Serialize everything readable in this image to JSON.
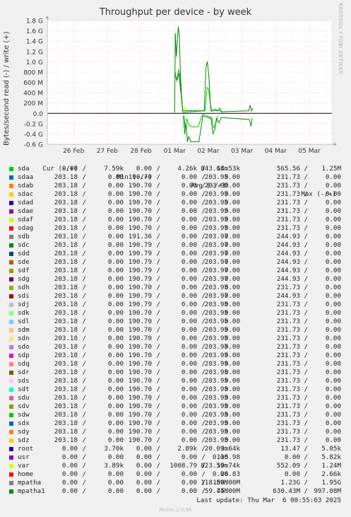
{
  "chart_data": {
    "type": "line",
    "title": "Throughput per device - by week",
    "ylabel": "Bytes/second read (-) / write (+)",
    "ylim": [
      -0.6,
      1.8
    ],
    "yunit": "G",
    "yticks": [
      "1.8 G",
      "1.6 G",
      "1.4 G",
      "1.2 G",
      "1.0 G",
      "800 M",
      "600 M",
      "400 M",
      "200 M",
      "0.0",
      "-0.2 G",
      "-0.4 G",
      "-0.6 G"
    ],
    "xticks": [
      "26 Feb",
      "27 Feb",
      "28 Feb",
      "01 Mar",
      "02 Mar",
      "03 Mar",
      "04 Mar",
      "05 Mar"
    ],
    "grid": true,
    "series": [
      {
        "name": "sda",
        "color": "#00cc00",
        "write_points_G": [
          [
            3.02,
            0.8
          ],
          [
            3.06,
            0.62
          ],
          [
            3.09,
            0.75
          ],
          [
            3.12,
            0.85
          ],
          [
            3.16,
            0.72
          ],
          [
            3.2,
            0.3
          ],
          [
            3.24,
            0.02
          ],
          [
            3.9,
            0.05
          ],
          [
            3.96,
            0.5
          ],
          [
            4.0,
            0.48
          ],
          [
            4.04,
            0.3
          ],
          [
            4.08,
            0.05
          ],
          [
            4.36,
            0.05
          ],
          [
            4.4,
            0.02
          ]
        ],
        "read_points_G": [
          [
            3.28,
            -0.05
          ],
          [
            3.32,
            -0.3
          ],
          [
            3.36,
            -0.1
          ],
          [
            3.42,
            -0.22
          ],
          [
            3.5,
            -0.26
          ],
          [
            3.6,
            -0.26
          ],
          [
            3.7,
            -0.26
          ],
          [
            3.78,
            -0.1
          ],
          [
            3.84,
            -0.02
          ],
          [
            4.1,
            -0.08
          ],
          [
            4.16,
            -0.28
          ],
          [
            4.22,
            -0.2
          ],
          [
            4.28,
            -0.05
          ]
        ]
      },
      {
        "name": "var",
        "color": "#ccff00",
        "write_points_G": [
          [
            3.24,
            0.02
          ],
          [
            3.3,
            0.12
          ],
          [
            3.36,
            0.06
          ]
        ],
        "read_points_G": []
      },
      {
        "name": "mpatha1",
        "color": "#008f00",
        "write_points_G": [
          [
            3.0,
            0.02
          ],
          [
            3.02,
            1.55
          ],
          [
            3.05,
            1.1
          ],
          [
            3.08,
            1.4
          ],
          [
            3.11,
            1.68
          ],
          [
            3.14,
            1.5
          ],
          [
            3.17,
            0.8
          ],
          [
            3.2,
            0.4
          ],
          [
            3.24,
            0.05
          ],
          [
            3.88,
            0.05
          ],
          [
            3.93,
            0.9
          ],
          [
            3.97,
            1.0
          ],
          [
            4.02,
            0.7
          ],
          [
            4.06,
            0.2
          ],
          [
            4.1,
            0.04
          ],
          [
            4.2,
            0.08
          ],
          [
            4.28,
            0.05
          ],
          [
            4.34,
            0.1
          ],
          [
            4.4,
            0.03
          ],
          [
            5.2,
            0.05
          ],
          [
            5.24,
            0.15
          ],
          [
            5.28,
            0.05
          ],
          [
            5.32,
            0.1
          ]
        ],
        "read_points_G": [
          [
            3.26,
            -0.05
          ],
          [
            3.3,
            -0.4
          ],
          [
            3.34,
            -0.2
          ],
          [
            3.38,
            -0.55
          ],
          [
            3.42,
            -0.45
          ],
          [
            3.48,
            -0.55
          ],
          [
            3.6,
            -0.55
          ],
          [
            3.72,
            -0.55
          ],
          [
            3.78,
            -0.3
          ],
          [
            3.84,
            -0.05
          ],
          [
            4.08,
            -0.1
          ],
          [
            4.14,
            -0.4
          ],
          [
            4.2,
            -0.3
          ],
          [
            4.24,
            -0.1
          ],
          [
            4.32,
            -0.18
          ],
          [
            4.38,
            -0.08
          ],
          [
            5.22,
            -0.12
          ],
          [
            5.27,
            -0.25
          ],
          [
            5.3,
            -0.1
          ]
        ]
      },
      {
        "name": "sdb",
        "color": "#3c6e28",
        "write_points_G": [
          [
            3.02,
            0.72
          ],
          [
            3.08,
            0.66
          ],
          [
            3.13,
            0.78
          ],
          [
            3.18,
            0.4
          ]
        ],
        "read_points_G": []
      }
    ]
  },
  "title": "Throughput per device - by week",
  "ylabel_text": "Bytes/second read (-) / write (+)",
  "watermark": "RRDTOOL / TOBI OETIKER",
  "legend": {
    "headers": {
      "cur": "Cur (-/+)",
      "min": "Min (-/+)",
      "avg": "Avg (-/+)",
      "max": "Max (-/+)"
    },
    "rows": [
      {
        "name": "sda",
        "color": "#00cc00",
        "cur_r": "0.00",
        "cur_w": "7.59k",
        "min_r": "0.00",
        "min_w": "4.26k",
        "avg_r": "843.68m",
        "avg_w": "14.53k",
        "max_r": "565.56",
        "max_w": "1.25M"
      },
      {
        "name": "sdaa",
        "color": "#0066b3",
        "cur_r": "203.18",
        "cur_w": "0.00",
        "min_r": "190.70",
        "min_w": "0.00",
        "avg_r": "203.95",
        "avg_w": "0.00",
        "max_r": "231.73",
        "max_w": "0.00"
      },
      {
        "name": "sdab",
        "color": "#ff8000",
        "cur_r": "203.18",
        "cur_w": "0.00",
        "min_r": "190.70",
        "min_w": "0.00",
        "avg_r": "203.95",
        "avg_w": "0.00",
        "max_r": "231.73",
        "max_w": "0.00"
      },
      {
        "name": "sdac",
        "color": "#ffcc00",
        "cur_r": "203.18",
        "cur_w": "0.00",
        "min_r": "190.70",
        "min_w": "0.00",
        "avg_r": "203.95",
        "avg_w": "0.00",
        "max_r": "231.73",
        "max_w": "0.00"
      },
      {
        "name": "sdad",
        "color": "#330099",
        "cur_r": "203.18",
        "cur_w": "0.00",
        "min_r": "190.70",
        "min_w": "0.00",
        "avg_r": "203.95",
        "avg_w": "0.00",
        "max_r": "231.73",
        "max_w": "0.00"
      },
      {
        "name": "sdae",
        "color": "#990099",
        "cur_r": "203.18",
        "cur_w": "0.00",
        "min_r": "190.70",
        "min_w": "0.00",
        "avg_r": "203.95",
        "avg_w": "0.00",
        "max_r": "231.73",
        "max_w": "0.00"
      },
      {
        "name": "sdaf",
        "color": "#ccff00",
        "cur_r": "203.18",
        "cur_w": "0.00",
        "min_r": "190.70",
        "min_w": "0.00",
        "avg_r": "203.95",
        "avg_w": "0.00",
        "max_r": "231.73",
        "max_w": "0.00"
      },
      {
        "name": "sdag",
        "color": "#ff0000",
        "cur_r": "203.18",
        "cur_w": "0.00",
        "min_r": "190.70",
        "min_w": "0.00",
        "avg_r": "203.95",
        "avg_w": "0.00",
        "max_r": "231.73",
        "max_w": "0.00"
      },
      {
        "name": "sdb",
        "color": "#808080",
        "cur_r": "203.18",
        "cur_w": "0.00",
        "min_r": "191.36",
        "min_w": "0.00",
        "avg_r": "203.97",
        "avg_w": "0.00",
        "max_r": "244.93",
        "max_w": "0.00"
      },
      {
        "name": "sdc",
        "color": "#008f00",
        "cur_r": "203.18",
        "cur_w": "0.00",
        "min_r": "190.79",
        "min_w": "0.00",
        "avg_r": "203.97",
        "avg_w": "0.00",
        "max_r": "244.93",
        "max_w": "0.00"
      },
      {
        "name": "sdd",
        "color": "#00487d",
        "cur_r": "203.18",
        "cur_w": "0.00",
        "min_r": "190.79",
        "min_w": "0.00",
        "avg_r": "203.97",
        "avg_w": "0.00",
        "max_r": "244.93",
        "max_w": "0.00"
      },
      {
        "name": "sde",
        "color": "#b35a00",
        "cur_r": "203.18",
        "cur_w": "0.00",
        "min_r": "190.79",
        "min_w": "0.00",
        "avg_r": "203.97",
        "avg_w": "0.00",
        "max_r": "244.93",
        "max_w": "0.00"
      },
      {
        "name": "sdf",
        "color": "#b38f00",
        "cur_r": "203.18",
        "cur_w": "0.00",
        "min_r": "190.79",
        "min_w": "0.00",
        "avg_r": "203.97",
        "avg_w": "0.00",
        "max_r": "244.93",
        "max_w": "0.00"
      },
      {
        "name": "sdg",
        "color": "#6b006b",
        "cur_r": "203.18",
        "cur_w": "0.00",
        "min_r": "190.79",
        "min_w": "0.00",
        "avg_r": "203.97",
        "avg_w": "0.00",
        "max_r": "244.93",
        "max_w": "0.00"
      },
      {
        "name": "sdh",
        "color": "#8fb300",
        "cur_r": "203.18",
        "cur_w": "0.00",
        "min_r": "190.70",
        "min_w": "0.00",
        "avg_r": "203.95",
        "avg_w": "0.00",
        "max_r": "231.73",
        "max_w": "0.00"
      },
      {
        "name": "sdi",
        "color": "#b30000",
        "cur_r": "203.18",
        "cur_w": "0.00",
        "min_r": "190.79",
        "min_w": "0.00",
        "avg_r": "203.97",
        "avg_w": "0.00",
        "max_r": "244.93",
        "max_w": "0.00"
      },
      {
        "name": "sdj",
        "color": "#bebebe",
        "cur_r": "203.18",
        "cur_w": "0.00",
        "min_r": "190.79",
        "min_w": "0.00",
        "avg_r": "203.95",
        "avg_w": "0.00",
        "max_r": "231.73",
        "max_w": "0.00"
      },
      {
        "name": "sdk",
        "color": "#80ff80",
        "cur_r": "203.18",
        "cur_w": "0.00",
        "min_r": "190.70",
        "min_w": "0.00",
        "avg_r": "203.95",
        "avg_w": "0.00",
        "max_r": "231.73",
        "max_w": "0.00"
      },
      {
        "name": "sdl",
        "color": "#80c9ff",
        "cur_r": "203.18",
        "cur_w": "0.00",
        "min_r": "190.70",
        "min_w": "0.00",
        "avg_r": "203.95",
        "avg_w": "0.00",
        "max_r": "231.73",
        "max_w": "0.00"
      },
      {
        "name": "sdm",
        "color": "#ffc080",
        "cur_r": "203.18",
        "cur_w": "0.00",
        "min_r": "190.70",
        "min_w": "0.00",
        "avg_r": "203.95",
        "avg_w": "0.00",
        "max_r": "231.73",
        "max_w": "0.00"
      },
      {
        "name": "sdn",
        "color": "#ffe680",
        "cur_r": "203.18",
        "cur_w": "0.00",
        "min_r": "190.70",
        "min_w": "0.00",
        "avg_r": "203.95",
        "avg_w": "0.00",
        "max_r": "231.73",
        "max_w": "0.00"
      },
      {
        "name": "sdo",
        "color": "#aa80ff",
        "cur_r": "203.18",
        "cur_w": "0.00",
        "min_r": "190.70",
        "min_w": "0.00",
        "avg_r": "203.95",
        "avg_w": "0.00",
        "max_r": "231.73",
        "max_w": "0.00"
      },
      {
        "name": "sdp",
        "color": "#ee00cc",
        "cur_r": "203.18",
        "cur_w": "0.00",
        "min_r": "190.70",
        "min_w": "0.00",
        "avg_r": "203.95",
        "avg_w": "0.00",
        "max_r": "231.73",
        "max_w": "0.00"
      },
      {
        "name": "sdq",
        "color": "#ff8080",
        "cur_r": "203.18",
        "cur_w": "0.00",
        "min_r": "190.70",
        "min_w": "0.00",
        "avg_r": "203.95",
        "avg_w": "0.00",
        "max_r": "231.73",
        "max_w": "0.00"
      },
      {
        "name": "sdr",
        "color": "#666600",
        "cur_r": "203.18",
        "cur_w": "0.00",
        "min_r": "190.70",
        "min_w": "0.00",
        "avg_r": "203.95",
        "avg_w": "0.00",
        "max_r": "231.73",
        "max_w": "0.00"
      },
      {
        "name": "sds",
        "color": "#ffbfff",
        "cur_r": "203.18",
        "cur_w": "0.00",
        "min_r": "190.70",
        "min_w": "0.00",
        "avg_r": "203.95",
        "avg_w": "0.00",
        "max_r": "231.73",
        "max_w": "0.00"
      },
      {
        "name": "sdt",
        "color": "#00ffcc",
        "cur_r": "203.18",
        "cur_w": "0.00",
        "min_r": "190.70",
        "min_w": "0.00",
        "avg_r": "203.95",
        "avg_w": "0.00",
        "max_r": "231.73",
        "max_w": "0.00"
      },
      {
        "name": "sdu",
        "color": "#cc6699",
        "cur_r": "203.18",
        "cur_w": "0.00",
        "min_r": "190.70",
        "min_w": "0.00",
        "avg_r": "203.95",
        "avg_w": "0.00",
        "max_r": "231.73",
        "max_w": "0.00"
      },
      {
        "name": "sdv",
        "color": "#999900",
        "cur_r": "203.18",
        "cur_w": "0.00",
        "min_r": "190.70",
        "min_w": "0.00",
        "avg_r": "203.95",
        "avg_w": "0.00",
        "max_r": "231.73",
        "max_w": "0.00"
      },
      {
        "name": "sdw",
        "color": "#00cc00",
        "cur_r": "203.18",
        "cur_w": "0.00",
        "min_r": "190.70",
        "min_w": "0.00",
        "avg_r": "203.95",
        "avg_w": "0.00",
        "max_r": "231.73",
        "max_w": "0.00"
      },
      {
        "name": "sdx",
        "color": "#0066b3",
        "cur_r": "203.18",
        "cur_w": "0.00",
        "min_r": "190.70",
        "min_w": "0.00",
        "avg_r": "203.95",
        "avg_w": "0.00",
        "max_r": "231.73",
        "max_w": "0.00"
      },
      {
        "name": "sdy",
        "color": "#ff8000",
        "cur_r": "203.18",
        "cur_w": "0.00",
        "min_r": "190.70",
        "min_w": "0.00",
        "avg_r": "203.95",
        "avg_w": "0.00",
        "max_r": "231.73",
        "max_w": "0.00"
      },
      {
        "name": "sdz",
        "color": "#ffcc00",
        "cur_r": "203.18",
        "cur_w": "0.00",
        "min_r": "190.70",
        "min_w": "0.00",
        "avg_r": "203.95",
        "avg_w": "0.00",
        "max_r": "231.73",
        "max_w": "0.00"
      },
      {
        "name": "root",
        "color": "#330099",
        "cur_r": "0.00",
        "cur_w": "3.70k",
        "min_r": "0.00",
        "min_w": "2.89k",
        "avg_r": "20.09m",
        "avg_w": "3.64k",
        "max_r": "13.47",
        "max_w": "5.05k"
      },
      {
        "name": "usr",
        "color": "#990099",
        "cur_r": "0.00",
        "cur_w": "0.00",
        "min_r": "0.00",
        "min_w": "0.00",
        "avg_r": "0.00",
        "avg_w": "115.98",
        "max_r": "0.00",
        "max_w": "5.82k"
      },
      {
        "name": "var",
        "color": "#ccff00",
        "cur_r": "0.00",
        "cur_w": "3.89k",
        "min_r": "0.00",
        "min_w": "1008.79",
        "avg_r": "823.59m",
        "avg_w": "10.74k",
        "max_r": "552.09",
        "max_w": "1.24M"
      },
      {
        "name": "home",
        "color": "#ff0000",
        "cur_r": "0.00",
        "cur_w": "0.00",
        "min_r": "0.00",
        "min_w": "0.00",
        "avg_r": "0.00",
        "avg_w": "26.83",
        "max_r": "0.00",
        "max_w": "2.66k"
      },
      {
        "name": "mpatha",
        "color": "#808080",
        "cur_r": "0.00",
        "cur_w": "0.00",
        "min_r": "0.00",
        "min_w": "0.00",
        "avg_r": "118.89M",
        "avg_w": "150.00M",
        "max_r": "1.23G",
        "max_w": "1.95G"
      },
      {
        "name": "mpatha1",
        "color": "#008f00",
        "cur_r": "0.00",
        "cur_w": "0.00",
        "min_r": "0.00",
        "min_w": "0.00",
        "avg_r": "59.44M",
        "avg_w": "75.00M",
        "max_r": "630.43M",
        "max_w": "997.08M"
      }
    ]
  },
  "last_update": "Last update: Thu Mar  6 00:55:03 2025",
  "footer": "Munin 2.0.56"
}
